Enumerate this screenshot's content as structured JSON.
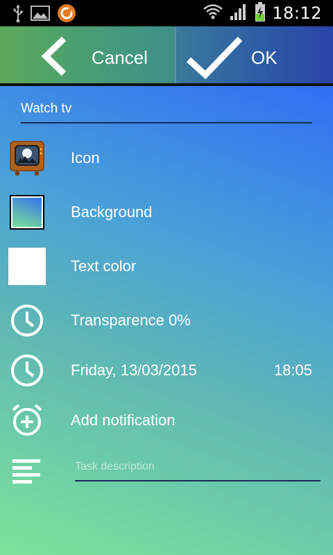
{
  "status_bar": {
    "time": "18:12",
    "icons": [
      "usb-icon",
      "image-icon",
      "app-notification-icon",
      "wifi-icon",
      "signal-icon",
      "battery-charging-icon"
    ]
  },
  "action_bar": {
    "cancel_label": "Cancel",
    "ok_label": "OK",
    "colors": {
      "cancel_start": "#5ea85a",
      "ok_end": "#2a44a8"
    }
  },
  "form": {
    "title_value": "Watch tv",
    "rows": [
      {
        "label": "Icon",
        "icon": "tv-icon"
      },
      {
        "label": "Background",
        "icon": "background-swatch"
      },
      {
        "label": "Text color",
        "icon": "text-color-swatch"
      },
      {
        "label": "Transparence 0%",
        "icon": "clock-icon"
      },
      {
        "label": "Friday, 13/03/2015",
        "right": "18:05",
        "icon": "clock-icon"
      },
      {
        "label": "Add notification",
        "icon": "alarm-add-icon"
      }
    ],
    "description_placeholder": "Task description",
    "description_icon": "text-lines-icon"
  },
  "colors": {
    "gradient_top": "#2f6ff5",
    "gradient_bottom": "#7de39a",
    "text_color": "#ffffff"
  }
}
